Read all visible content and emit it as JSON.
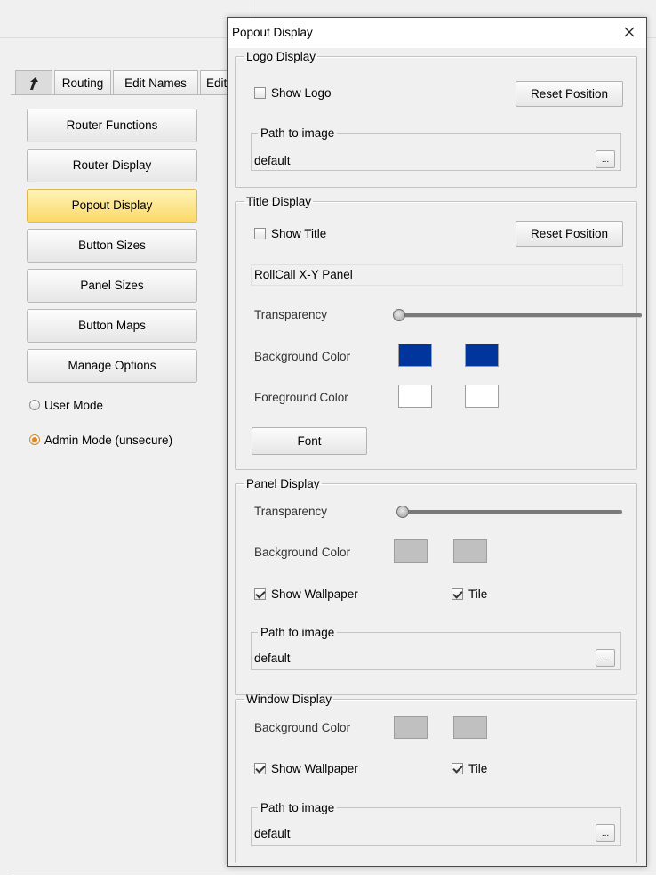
{
  "main_window": {
    "tabs": [
      {
        "icon": "arrow-icon"
      },
      {
        "label": "Routing"
      },
      {
        "label": "Edit Names"
      },
      {
        "label": "Edit"
      }
    ],
    "sidebar_buttons": [
      "Router Functions",
      "Router Display",
      "Popout Display",
      "Button Sizes",
      "Panel Sizes",
      "Button Maps",
      "Manage Options"
    ],
    "selected_button": "Popout Display",
    "modes": [
      {
        "label": "User Mode",
        "selected": false
      },
      {
        "label": "Admin Mode (unsecure)",
        "selected": true
      }
    ]
  },
  "popout": {
    "title": "Popout Display",
    "logo_display": {
      "legend": "Logo Display",
      "show_logo_label": "Show Logo",
      "show_logo_checked": false,
      "reset_label": "Reset Position",
      "path_legend": "Path to image",
      "path_value": "default",
      "browse_label": "..."
    },
    "title_display": {
      "legend": "Title Display",
      "show_title_label": "Show Title",
      "show_title_checked": false,
      "reset_label": "Reset Position",
      "title_text": "RollCall X-Y Panel",
      "transparency_label": "Transparency",
      "transparency_value": 0,
      "background_label": "Background Color",
      "background_colors": [
        "#00359b",
        "#00359b"
      ],
      "foreground_label": "Foreground Color",
      "foreground_colors": [
        "#ffffff",
        "#ffffff"
      ],
      "font_label": "Font"
    },
    "panel_display": {
      "legend": "Panel Display",
      "transparency_label": "Transparency",
      "transparency_value": 0,
      "background_label": "Background Color",
      "background_colors": [
        "#c0c0c0",
        "#c0c0c0"
      ],
      "show_wallpaper_label": "Show Wallpaper",
      "show_wallpaper_checked": true,
      "tile_label": "Tile",
      "tile_checked": true,
      "path_legend": "Path to image",
      "path_value": "default",
      "browse_label": "..."
    },
    "window_display": {
      "legend": "Window Display",
      "background_label": "Background Color",
      "background_colors": [
        "#c0c0c0",
        "#c0c0c0"
      ],
      "show_wallpaper_label": "Show Wallpaper",
      "show_wallpaper_checked": true,
      "tile_label": "Tile",
      "tile_checked": true,
      "path_legend": "Path to image",
      "path_value": "default",
      "browse_label": "..."
    }
  }
}
